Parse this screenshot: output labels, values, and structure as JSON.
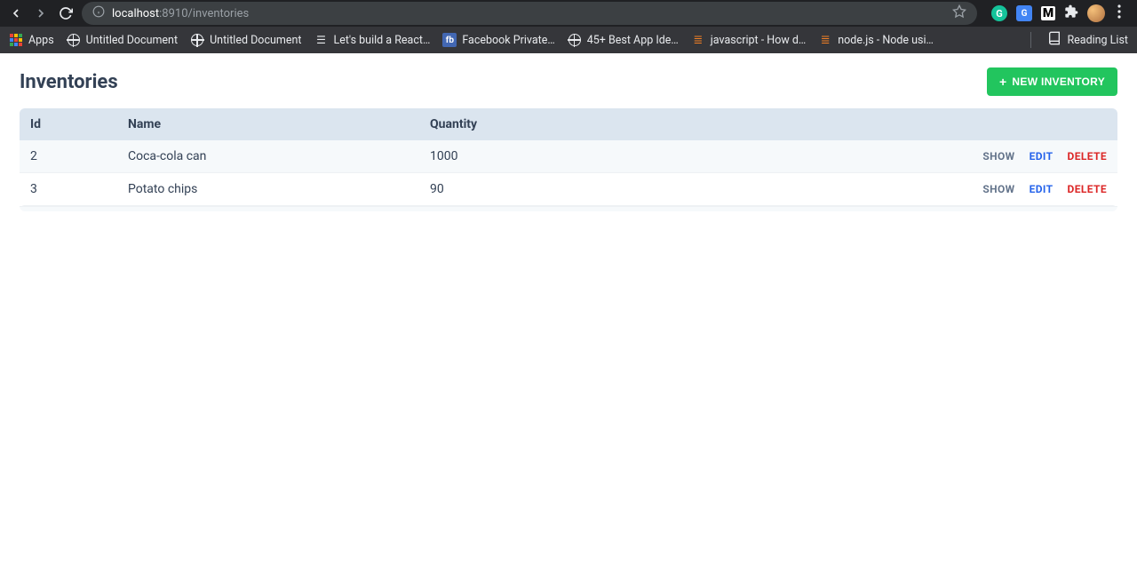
{
  "browser": {
    "url_host": "localhost",
    "url_port_path": ":8910/inventories",
    "bookmarks": {
      "apps": "Apps",
      "items": [
        {
          "label": "Untitled Document",
          "icon": "globe"
        },
        {
          "label": "Untitled Document",
          "icon": "globe"
        },
        {
          "label": "Let's build a React…",
          "icon": "list"
        },
        {
          "label": "Facebook Private…",
          "icon": "fb"
        },
        {
          "label": "45+ Best App Ide…",
          "icon": "globe"
        },
        {
          "label": "javascript - How d…",
          "icon": "so"
        },
        {
          "label": "node.js - Node usi…",
          "icon": "so"
        }
      ],
      "reading_list": "Reading List"
    }
  },
  "page": {
    "title": "Inventories",
    "new_button": "NEW INVENTORY",
    "table": {
      "headers": {
        "id": "Id",
        "name": "Name",
        "quantity": "Quantity"
      },
      "rows": [
        {
          "id": "2",
          "name": "Coca-cola can",
          "quantity": "1000"
        },
        {
          "id": "3",
          "name": "Potato chips",
          "quantity": "90"
        }
      ],
      "actions": {
        "show": "SHOW",
        "edit": "EDIT",
        "delete": "DELETE"
      }
    }
  }
}
